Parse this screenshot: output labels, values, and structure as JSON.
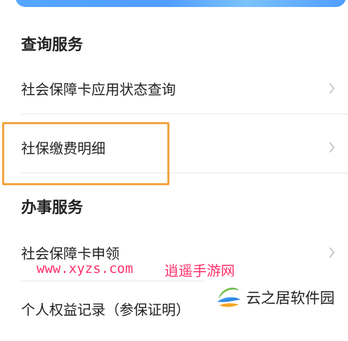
{
  "sections": {
    "query_title": "查询服务",
    "service_title": "办事服务"
  },
  "items": {
    "card_status_query": "社会保障卡应用状态查询",
    "payment_details": "社保缴费明细",
    "card_application": "社会保障卡申领",
    "personal_rights_record": "个人权益记录（参保证明）"
  },
  "watermark": {
    "url": "www.xyzs.com",
    "site_name": "逍遥手游网"
  },
  "logo": {
    "text": "云之居软件园"
  },
  "colors": {
    "highlight": "#f3a441",
    "watermark": "#ff2f6a",
    "banner": "#4f9dff"
  },
  "icons": {
    "chevron": "chevron-right-icon",
    "logo": "logo-swoosh-icon"
  }
}
